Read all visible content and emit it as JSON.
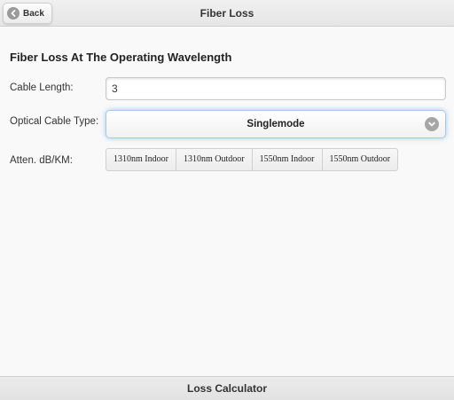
{
  "header": {
    "title": "Fiber Loss",
    "back_label": "Back"
  },
  "main": {
    "section_title": "Fiber Loss At The Operating Wavelength",
    "cable_length": {
      "label": "Cable Length:",
      "value": "3"
    },
    "cable_type": {
      "label": "Optical Cable Type:",
      "selected": "Singlemode"
    },
    "attenuation": {
      "label": "Atten. dB/KM:",
      "options": [
        "1310nm Indoor",
        "1310nm Outdoor",
        "1550nm Indoor",
        "1550nm Outdoor"
      ]
    }
  },
  "footer": {
    "title": "Loss Calculator"
  },
  "icons": {
    "back": "arrow-left-icon",
    "select": "chevron-down-icon"
  },
  "colors": {
    "focus_glow": "#3891da",
    "icon_gray": "#9a9a9a"
  }
}
